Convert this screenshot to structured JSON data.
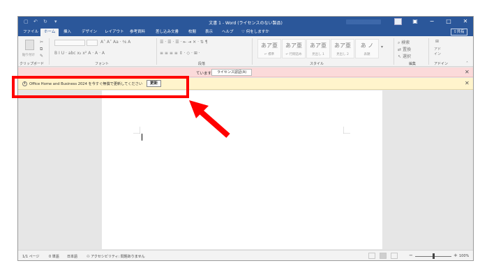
{
  "titlebar": {
    "document_title": "文書 1  -  Word (ライセンスのない製品)",
    "user_name": "xxxxxxxx xxxx",
    "minimize": "−",
    "restore": "□",
    "close": "✕",
    "save_icon": "save-icon",
    "undo_icon": "undo-icon",
    "redo_icon": "redo-icon"
  },
  "tabs": [
    "ファイル",
    "ホーム",
    "挿入",
    "デザイン",
    "レイアウト",
    "参考資料",
    "差し込み文書",
    "校閲",
    "表示",
    "ヘルプ"
  ],
  "active_tab": "ホーム",
  "tell_me": "何をしますか",
  "share_label": "共有",
  "ribbon": {
    "groups": {
      "clipboard": "クリップボード",
      "font": "フォント",
      "paragraph": "段落",
      "styles": "スタイル",
      "editing": "編集",
      "addins": "アドイン"
    },
    "paste_label": "貼り付け",
    "font_row1": "A˄  A˅   Aa  ·   ⅍  A",
    "font_row2": "B   I   U  ·  abc  x₂  x²   A  ·  A  ·  A",
    "para_row1": "☰ · ☰ · ☰ ·   ⇤  ⇥   ✕ ·   ⇅   ¶",
    "para_row2": "≡  ≡  ≡  ≡   ⇕ ·   ◇ ·   ⊞ ·",
    "style_tiles": [
      {
        "big": "あア亜",
        "label": "↵ 標準"
      },
      {
        "big": "あア亜",
        "label": "↵ 行間詰め"
      },
      {
        "big": "あア亜",
        "label": "見出し 1"
      },
      {
        "big": "あア亜",
        "label": "見出し 2"
      },
      {
        "big": "あ ノ",
        "label": "表題"
      }
    ],
    "edit_find": "検索",
    "edit_replace": "置換",
    "edit_select": "選択",
    "addin_label": "アド\nイン"
  },
  "license_bar": {
    "text": "ています。",
    "button": "ライセンス認証(A)",
    "close": "✕"
  },
  "renew_bar": {
    "info": "i",
    "text": "Office Home and Business 2024 を今すぐ無償で更新してください",
    "button": "更新",
    "close": "✕"
  },
  "statusbar": {
    "page": "1/1 ページ",
    "words": "0 単語",
    "language": "日本語",
    "accessibility": "アクセシビリティ: 問題ありません",
    "zoom": "100%",
    "zoom_minus": "−",
    "zoom_plus": "+",
    "zoom_level": 0.5
  },
  "colors": {
    "word_blue": "#2b579a",
    "license_bar": "#fbdada",
    "renew_bar": "#fff4cc",
    "highlight": "#ff0000"
  }
}
